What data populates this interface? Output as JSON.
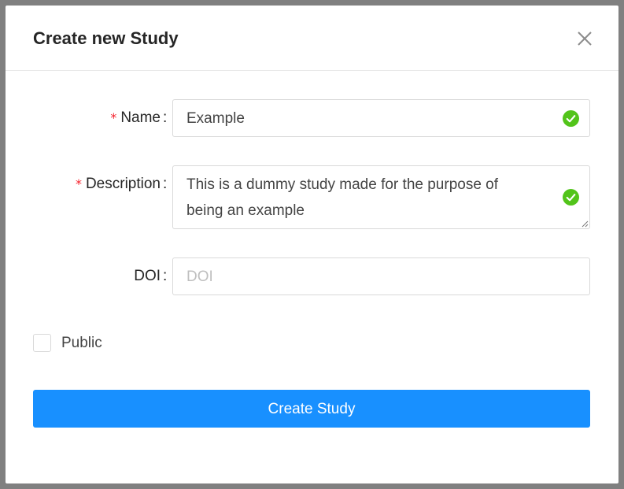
{
  "dialog": {
    "title": "Create new Study",
    "close_icon": "close-icon"
  },
  "form": {
    "name": {
      "required_mark": "*",
      "label": "Name",
      "colon": ":",
      "value": "Example",
      "status_icon": "check-circle-icon",
      "status_color": "#52c41a"
    },
    "description": {
      "required_mark": "*",
      "label": "Description",
      "colon": ":",
      "value_line_1": "This is a dummy study made for the purpose of",
      "value_line_2": "being an example",
      "status_icon": "check-circle-icon",
      "status_color": "#52c41a"
    },
    "doi": {
      "label": "DOI",
      "colon": ":",
      "value": "",
      "placeholder": "DOI"
    },
    "public": {
      "label": "Public",
      "checked": false
    },
    "submit_label": "Create Study"
  },
  "colors": {
    "primary": "#1890ff",
    "required": "#f5222d",
    "success": "#52c41a",
    "border": "#d9d9d9",
    "overlay": "#808080"
  }
}
